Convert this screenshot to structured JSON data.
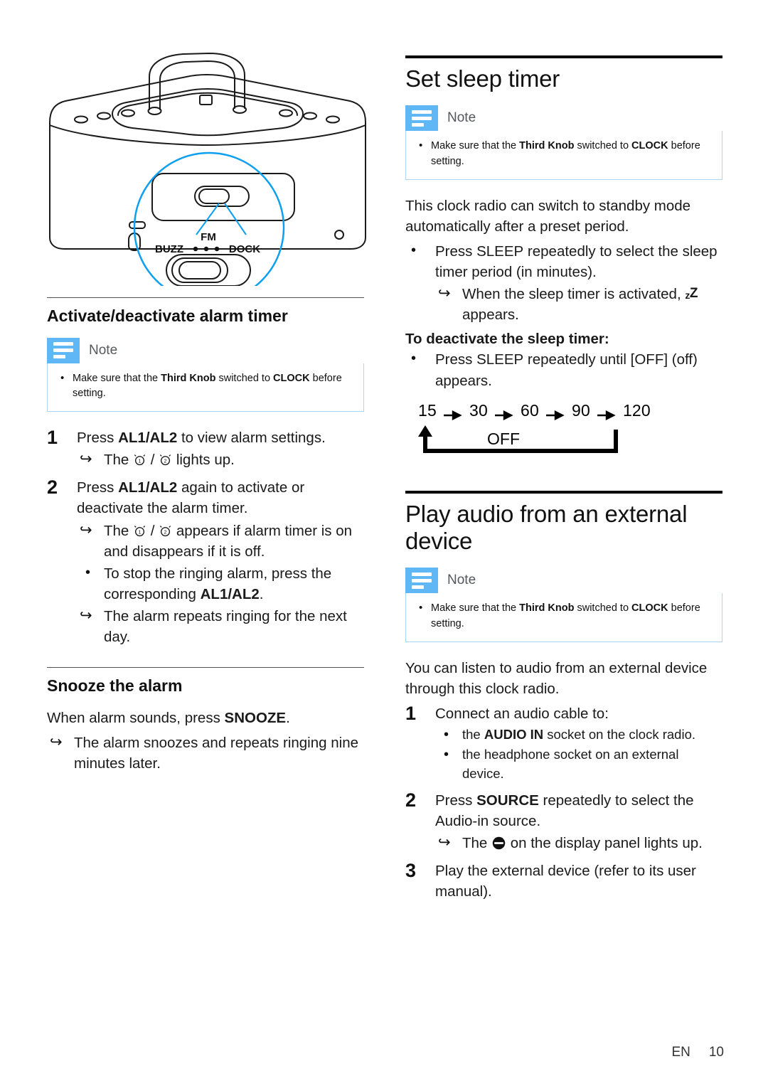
{
  "page": {
    "language_code": "EN",
    "page_number": "10"
  },
  "illustration": {
    "name": "clock-radio-rear-view-with-callout",
    "callout_labels": {
      "top": "FM",
      "left": "BUZZ",
      "right": "DOCK",
      "dots": "• • •"
    }
  },
  "note_common": {
    "label": "Note",
    "bullet_prefix": "Make sure that the ",
    "bold_1": "Third Knob",
    "middle": " switched to ",
    "bold_2": "CLOCK",
    "suffix": " before setting."
  },
  "left_column": {
    "section_alarm": {
      "title": "Activate/deactivate alarm timer",
      "steps": [
        {
          "num": "1",
          "text_before": "Press ",
          "bold": "AL1/AL2",
          "text_after": " to view alarm settings.",
          "subs": [
            {
              "type": "arrow",
              "before": "The ",
              "icon": "alarm-1-icon",
              "mid": " / ",
              "icon2": "alarm-2-icon",
              "after": " lights up."
            }
          ]
        },
        {
          "num": "2",
          "text_before": "Press ",
          "bold": "AL1/AL2",
          "text_after": " again to activate or deactivate the alarm timer.",
          "subs": [
            {
              "type": "arrow",
              "before": "The ",
              "icon": "alarm-1-icon",
              "mid": " / ",
              "icon2": "alarm-2-icon",
              "after": " appears if alarm timer is on and disappears if it is off."
            },
            {
              "type": "bullet",
              "before": "To stop the ringing alarm, press the corresponding ",
              "bold": "AL1/AL2",
              "after": "."
            },
            {
              "type": "arrow",
              "before": "The alarm repeats ringing for the next day."
            }
          ]
        }
      ]
    },
    "section_snooze": {
      "title": "Snooze the alarm",
      "lead_before": "When alarm sounds, press ",
      "lead_bold": "SNOOZE",
      "lead_after": ".",
      "result": "The alarm snoozes and repeats ringing nine minutes later."
    }
  },
  "right_column": {
    "section_sleep": {
      "title": "Set sleep timer",
      "intro": "This clock radio can switch to standby mode automatically after a preset period.",
      "bullet_1_before": "Press ",
      "bullet_1_bold": "SLEEP",
      "bullet_1_after": " repeatedly to select the sleep timer period (in minutes).",
      "bullet_1_result_before": "When the sleep timer is activated, ",
      "bullet_1_result_icon": "sleep-zz-icon",
      "bullet_1_result_after": " appears.",
      "deactivate_heading": "To deactivate the sleep timer:",
      "deactivate_before": "Press ",
      "deactivate_bold": "SLEEP",
      "deactivate_mid": " repeatedly until ",
      "deactivate_bracket": "[OFF]",
      "deactivate_after": " (off) appears."
    },
    "section_external": {
      "title": "Play audio from an external device",
      "intro": "You can listen to audio from an external device through this clock radio.",
      "steps": [
        {
          "num": "1",
          "text": "Connect an audio cable to:",
          "subs": [
            {
              "type": "bullet",
              "before": "the ",
              "bold": "AUDIO IN",
              "after": " socket on the clock radio."
            },
            {
              "type": "bullet",
              "before": "the headphone socket on an external device."
            }
          ]
        },
        {
          "num": "2",
          "text_before": "Press ",
          "bold": "SOURCE",
          "text_after": " repeatedly to select the Audio-in source.",
          "subs": [
            {
              "type": "arrow",
              "before": "The ",
              "icon": "audio-in-icon",
              "after": " on the display panel lights up."
            }
          ]
        },
        {
          "num": "3",
          "text": "Play the external device (refer to its user manual).",
          "subs": []
        }
      ]
    }
  },
  "chart_data": {
    "type": "diagram",
    "title": "Sleep timer period cycle",
    "nodes": [
      "15",
      "30",
      "60",
      "90",
      "120",
      "OFF"
    ],
    "sequence": [
      "15",
      "30",
      "60",
      "90",
      "120",
      "OFF",
      "15"
    ],
    "unit": "minutes"
  },
  "colors": {
    "note_accent": "#5fb8f5",
    "note_border": "#aed4f5",
    "callout_blue": "#0d9ff0",
    "rule_black": "#000000"
  }
}
